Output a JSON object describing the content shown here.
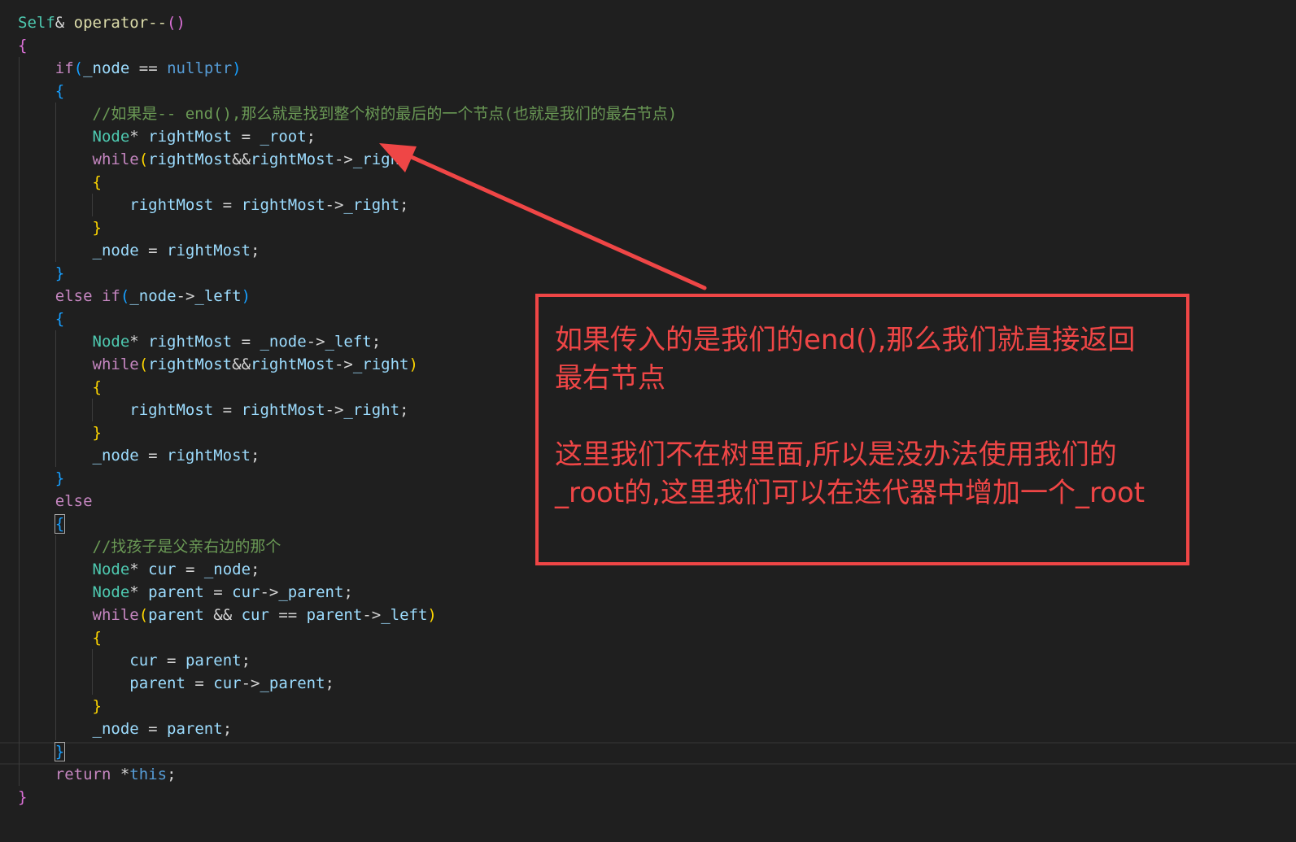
{
  "code": {
    "lines": [
      "Self& operator--()",
      "{",
      "    if(_node == nullptr)",
      "    {",
      "        //如果是-- end(),那么就是找到整个树的最后的一个节点(也就是我们的最右节点)",
      "        Node* rightMost = _root;",
      "        while(rightMost&&rightMost->_righ",
      "        {",
      "            rightMost = rightMost->_right;",
      "        }",
      "        _node = rightMost;",
      "    }",
      "    else if(_node->_left)",
      "    {",
      "        Node* rightMost = _node->_left;",
      "        while(rightMost&&rightMost->_right)",
      "        {",
      "            rightMost = rightMost->_right;",
      "        }",
      "        _node = rightMost;",
      "    }",
      "    else",
      "    {",
      "        //找孩子是父亲右边的那个",
      "        Node* cur = _node;",
      "        Node* parent = cur->_parent;",
      "        while(parent && cur == parent->_left)",
      "        {",
      "            cur = parent;",
      "            parent = cur->_parent;",
      "        }",
      "        _node = parent;",
      "    }",
      "    return *this;",
      "}"
    ]
  },
  "annotation": {
    "text": "如果传入的是我们的end(),那么我们就直接返回\n最右节点\n\n这里我们不在树里面,所以是没办法使用我们的\n_root的,这里我们可以在迭代器中增加一个_root",
    "color": "#ef4646"
  },
  "theme": {
    "background": "#1f1f1f",
    "type_color": "#4ec9b0",
    "keyword_color": "#c586c0",
    "literal_color": "#569cd6",
    "variable_color": "#9cdcfe",
    "comment_color": "#6a9955",
    "bracket_colors": [
      "#da70d6",
      "#179fff",
      "#ffd700"
    ]
  }
}
